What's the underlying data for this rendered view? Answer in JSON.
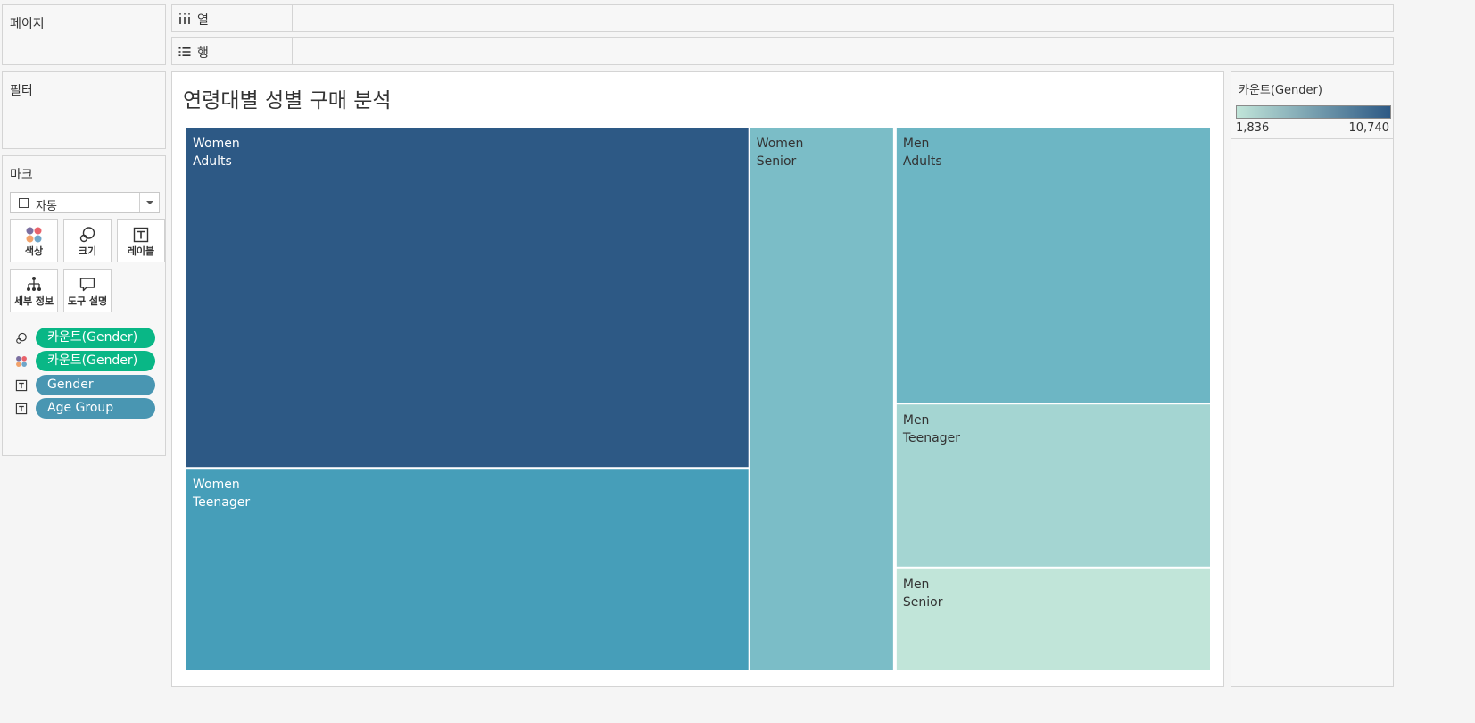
{
  "panels": {
    "pages_title": "페이지",
    "filters_title": "필터",
    "marks_title": "마크"
  },
  "marks": {
    "type_label": "자동",
    "buttons": [
      {
        "label": "색상",
        "icon": "color-dots-icon"
      },
      {
        "label": "크기",
        "icon": "size-circles-icon"
      },
      {
        "label": "레이블",
        "icon": "text-label-icon"
      },
      {
        "label": "세부 정보",
        "icon": "detail-tree-icon"
      },
      {
        "label": "도구 설명",
        "icon": "tooltip-bubble-icon"
      }
    ],
    "pills": [
      {
        "label": "카운트(Gender)",
        "icon": "size-circles-icon",
        "color": "#09b786"
      },
      {
        "label": "카운트(Gender)",
        "icon": "color-dots-icon",
        "color": "#09b786"
      },
      {
        "label": "Gender",
        "icon": "text-label-icon",
        "color": "#4996b2"
      },
      {
        "label": "Age Group",
        "icon": "text-label-icon",
        "color": "#4996b2"
      }
    ]
  },
  "shelves": {
    "columns_label": "열",
    "rows_label": "행"
  },
  "view": {
    "title": "연령대별 성별 구매 분석"
  },
  "legend": {
    "title": "카운트(Gender)",
    "min_label": "1,836",
    "max_label": "10,740",
    "color_low": "#c1e5d9",
    "color_high": "#2d5985"
  },
  "chart_data": {
    "type": "treemap",
    "title": "연령대별 성별 구매 분석",
    "measure": "카운트(Gender)",
    "color_range": [
      1836,
      10740
    ],
    "groups": [
      {
        "name": "Women",
        "items": [
          {
            "gender": "Women",
            "age_group": "Adults",
            "value": 10740
          },
          {
            "gender": "Women",
            "age_group": "Teenager",
            "value": 6400
          },
          {
            "gender": "Women",
            "age_group": "Senior",
            "value": 4400
          }
        ]
      },
      {
        "name": "Men",
        "items": [
          {
            "gender": "Men",
            "age_group": "Adults",
            "value": 4900
          },
          {
            "gender": "Men",
            "age_group": "Teenager",
            "value": 2900
          },
          {
            "gender": "Men",
            "age_group": "Senior",
            "value": 1836
          }
        ]
      }
    ]
  }
}
